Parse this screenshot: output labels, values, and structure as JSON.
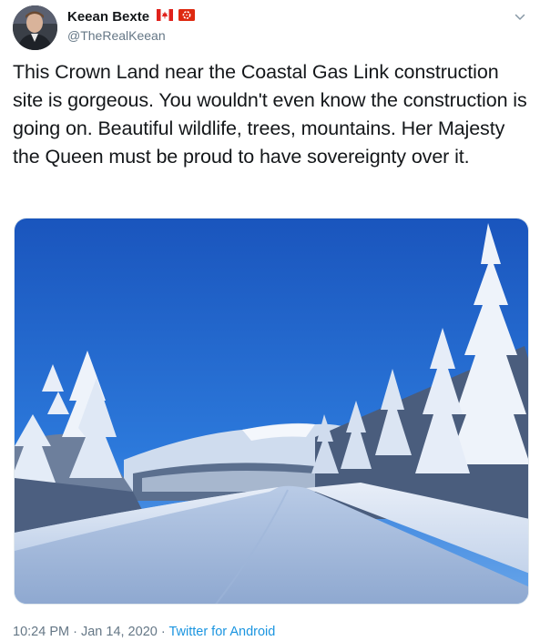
{
  "author": {
    "display_name": "Keean Bexte",
    "handle": "@TheRealKeean",
    "flags": [
      "canada-flag-icon",
      "hong-kong-flag-icon"
    ]
  },
  "tweet": {
    "text": "This Crown Land near the Coastal Gas Link construction site is gorgeous. You wouldn't even know the construction is going on. Beautiful wildlife, trees, mountains. Her Majesty the Queen must be proud to have sovereignty over it."
  },
  "meta": {
    "time": "10:24 PM",
    "separator": " · ",
    "date": "Jan 14, 2020",
    "source": "Twitter for Android"
  },
  "icons": {
    "menu": "chevron-down-icon"
  },
  "colors": {
    "link": "#1b95e0",
    "secondary_text": "#657786",
    "sky": "#1f64c8"
  }
}
